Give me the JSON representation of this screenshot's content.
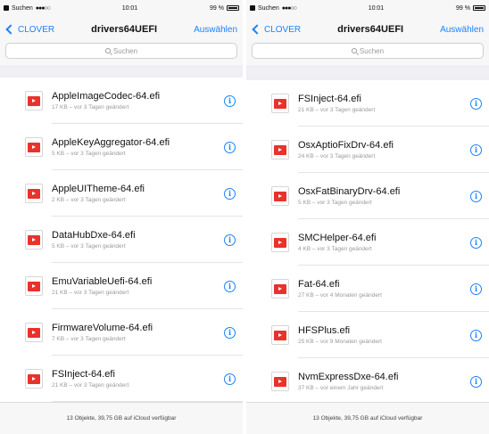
{
  "left": {
    "status": {
      "carrier": "Suchen",
      "time": "10:01",
      "battery": "99 %"
    },
    "nav": {
      "back": "CLOVER",
      "title": "drivers64UEFI",
      "action": "Auswählen"
    },
    "search": {
      "placeholder": "Suchen"
    },
    "files": [
      {
        "name": "AppleImageCodec-64.efi",
        "meta": "17 KB – vor 3 Tagen geändert"
      },
      {
        "name": "AppleKeyAggregator-64.efi",
        "meta": "5 KB – vor 3 Tagen geändert"
      },
      {
        "name": "AppleUITheme-64.efi",
        "meta": "2 KB – vor 3 Tagen geändert"
      },
      {
        "name": "DataHubDxe-64.efi",
        "meta": "5 KB – vor 3 Tagen geändert"
      },
      {
        "name": "EmuVariableUefi-64.efi",
        "meta": "21 KB – vor 3 Tagen geändert"
      },
      {
        "name": "FirmwareVolume-64.efi",
        "meta": "7 KB – vor 3 Tagen geändert"
      },
      {
        "name": "FSInject-64.efi",
        "meta": "21 KB – vor 3 Tagen geändert"
      }
    ],
    "footer": "13 Objekte, 39,75 GB auf iCloud verfügbar"
  },
  "right": {
    "status": {
      "carrier": "Suchen",
      "time": "10:01",
      "battery": "99 %"
    },
    "nav": {
      "back": "CLOVER",
      "title": "drivers64UEFI",
      "action": "Auswählen"
    },
    "search": {
      "placeholder": "Suchen"
    },
    "files": [
      {
        "name": "FSInject-64.efi",
        "meta": "21 KB – vor 3 Tagen geändert"
      },
      {
        "name": "OsxAptioFixDrv-64.efi",
        "meta": "24 KB – vor 3 Tagen geändert"
      },
      {
        "name": "OsxFatBinaryDrv-64.efi",
        "meta": "5 KB – vor 3 Tagen geändert"
      },
      {
        "name": "SMCHelper-64.efi",
        "meta": "4 KB – vor 3 Tagen geändert"
      },
      {
        "name": "Fat-64.efi",
        "meta": "27 KB – vor 4 Monaten geändert"
      },
      {
        "name": "HFSPlus.efi",
        "meta": "25 KB – vor 9 Monaten geändert"
      },
      {
        "name": "NvmExpressDxe-64.efi",
        "meta": "37 KB – vor einem Jahr geändert"
      }
    ],
    "footer": "13 Objekte, 39,75 GB auf iCloud verfügbar"
  },
  "colors": {
    "accent": "#1a82fb",
    "file_icon": "#e8322b",
    "background": "#efeff4"
  },
  "icons": [
    "chevron-left-icon",
    "search-icon",
    "pdf-file-icon",
    "info-icon",
    "battery-icon"
  ]
}
